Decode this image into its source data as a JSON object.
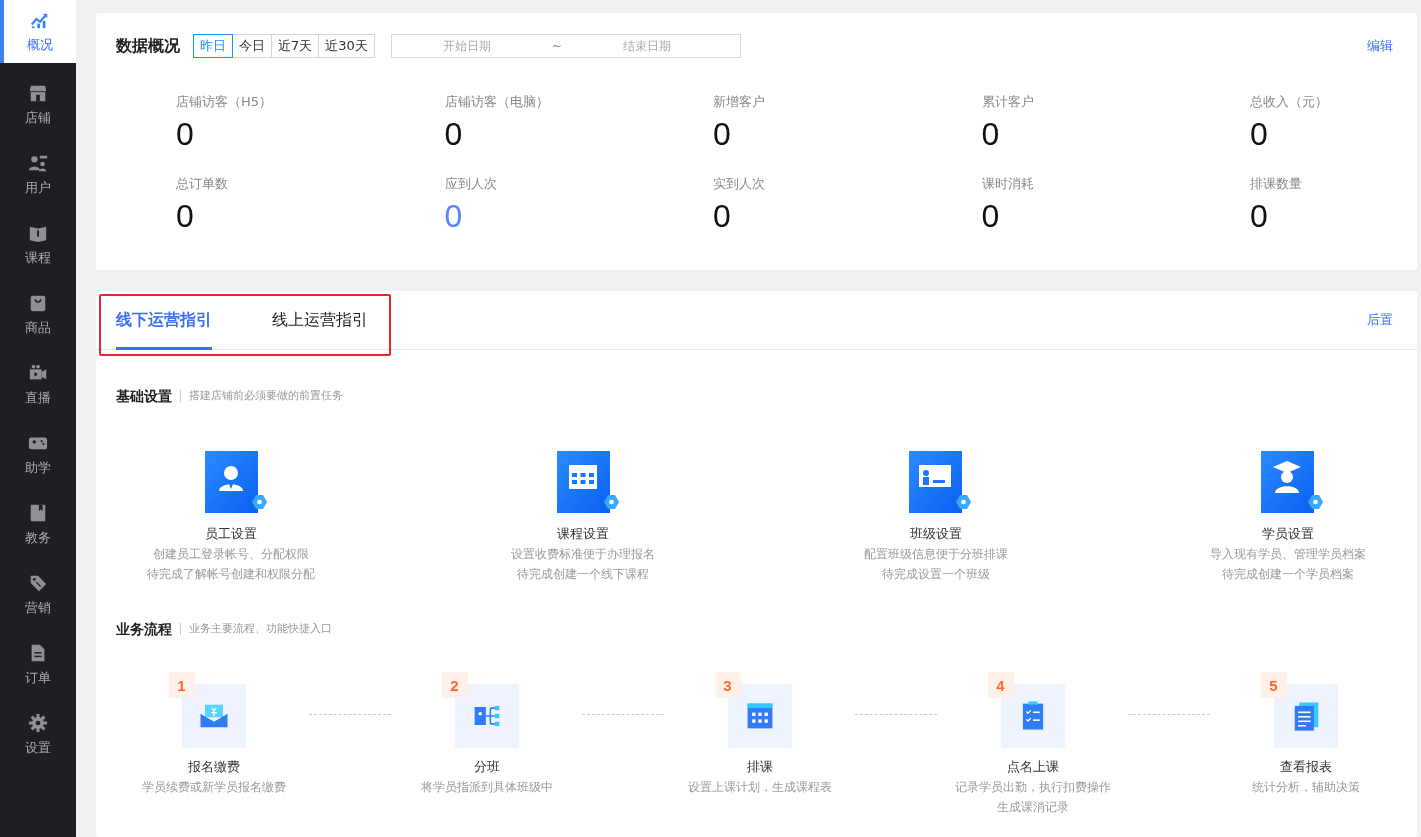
{
  "sidebar": {
    "items": [
      {
        "label": "概况",
        "selected": true
      },
      {
        "label": "店铺",
        "selected": false
      },
      {
        "label": "用户",
        "selected": false
      },
      {
        "label": "课程",
        "selected": false
      },
      {
        "label": "商品",
        "selected": false
      },
      {
        "label": "直播",
        "selected": false
      },
      {
        "label": "助学",
        "selected": false
      },
      {
        "label": "教务",
        "selected": false
      },
      {
        "label": "营销",
        "selected": false
      },
      {
        "label": "订单",
        "selected": false
      },
      {
        "label": "设置",
        "selected": false
      }
    ]
  },
  "overview": {
    "title": "数据概况",
    "periods": [
      {
        "label": "昨日",
        "selected": true
      },
      {
        "label": "今日",
        "selected": false
      },
      {
        "label": "近7天",
        "selected": false
      },
      {
        "label": "近30天",
        "selected": false
      }
    ],
    "date_range": {
      "start_placeholder": "开始日期",
      "separator": "~",
      "end_placeholder": "结束日期"
    },
    "edit_link": "编辑",
    "stats": [
      {
        "label": "店铺访客（H5）",
        "value": "0",
        "highlighted": false
      },
      {
        "label": "店铺访客（电脑）",
        "value": "0",
        "highlighted": false
      },
      {
        "label": "新增客户",
        "value": "0",
        "highlighted": false
      },
      {
        "label": "累计客户",
        "value": "0",
        "highlighted": false
      },
      {
        "label": "总收入（元）",
        "value": "0",
        "highlighted": false
      },
      {
        "label": "总订单数",
        "value": "0",
        "highlighted": false
      },
      {
        "label": "应到人次",
        "value": "0",
        "highlighted": true
      },
      {
        "label": "实到人次",
        "value": "0",
        "highlighted": false
      },
      {
        "label": "课时消耗",
        "value": "0",
        "highlighted": false
      },
      {
        "label": "排课数量",
        "value": "0",
        "highlighted": false
      }
    ]
  },
  "guide": {
    "tabs_framed": true,
    "tabs": [
      {
        "label": "线下运营指引",
        "selected": true
      },
      {
        "label": "线上运营指引",
        "selected": false
      }
    ],
    "action_link": "后置",
    "basic_setup": {
      "title": "基础设置",
      "subtitle": "搭建店铺前必须要做的前置任务",
      "items": [
        {
          "title": "员工设置",
          "description": "创建员工登录帐号、分配权限",
          "status": "待完成了解帐号创建和权限分配"
        },
        {
          "title": "课程设置",
          "description": "设置收费标准便于办理报名",
          "status": "待完成创建一个线下课程"
        },
        {
          "title": "班级设置",
          "description": "配置班级信息便于分班排课",
          "status": "待完成设置一个班级"
        },
        {
          "title": "学员设置",
          "description": "导入现有学员、管理学员档案",
          "status": "待完成创建一个学员档案"
        }
      ]
    },
    "workflow": {
      "title": "业务流程",
      "subtitle": "业务主要流程、功能快捷入口",
      "steps": [
        {
          "number": "1",
          "title": "报名缴费",
          "lines": [
            "学员续费或新学员报名缴费"
          ]
        },
        {
          "number": "2",
          "title": "分班",
          "lines": [
            "将学员指派到具体班级中"
          ]
        },
        {
          "number": "3",
          "title": "排课",
          "lines": [
            "设置上课计划，生成课程表"
          ]
        },
        {
          "number": "4",
          "title": "点名上课",
          "lines": [
            "记录学员出勤，执行扣费操作",
            "生成课消记录"
          ]
        },
        {
          "number": "5",
          "title": "查看报表",
          "lines": [
            "统计分析，辅助决策"
          ]
        }
      ]
    }
  }
}
